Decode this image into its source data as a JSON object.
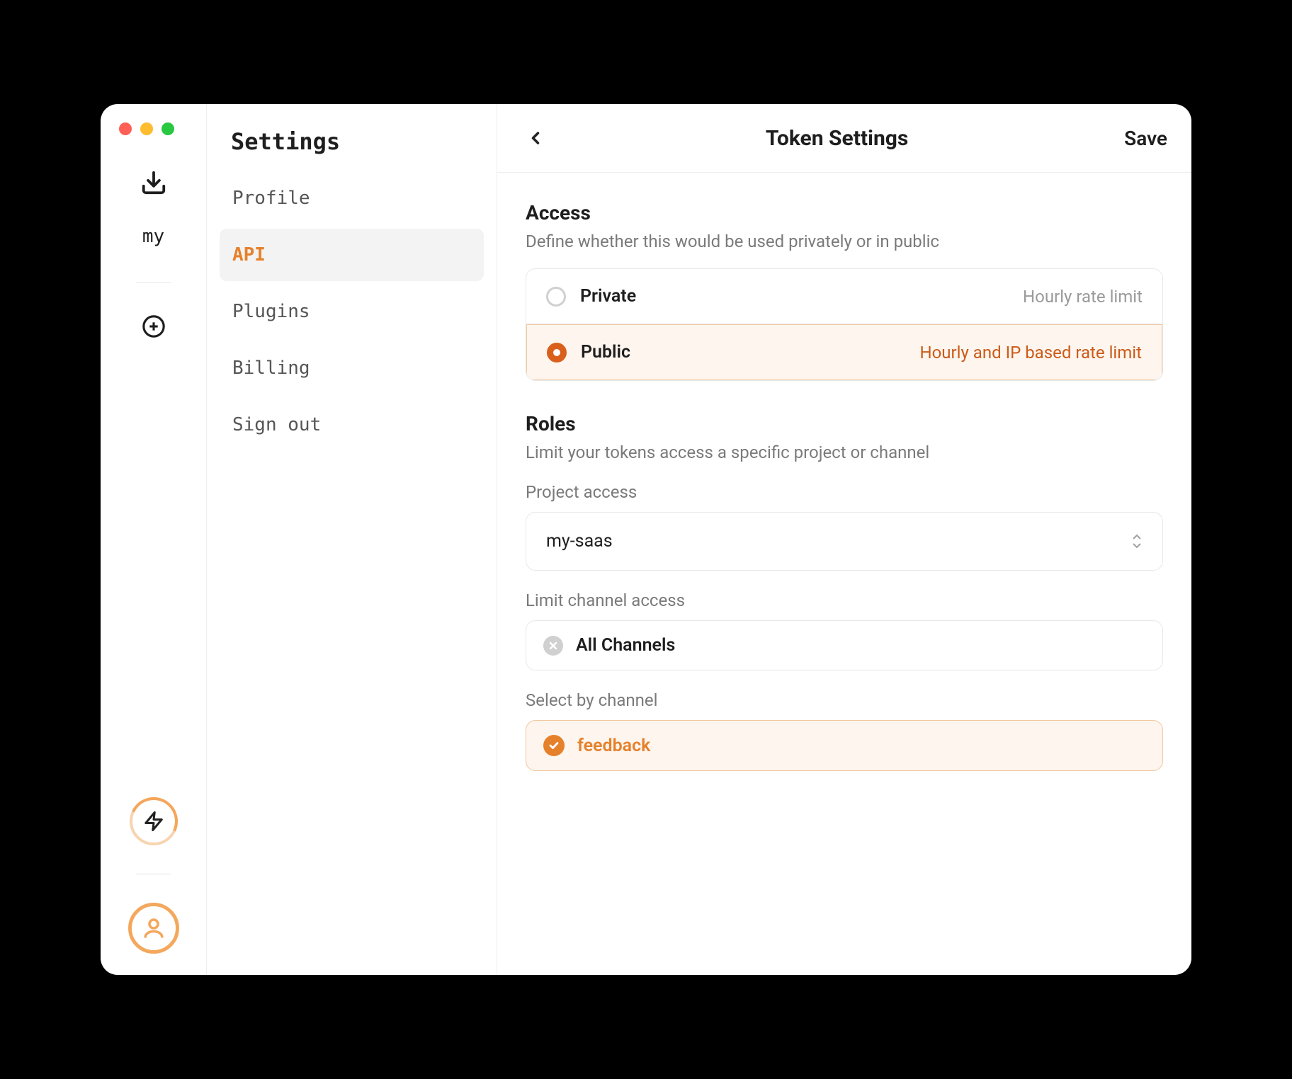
{
  "rail": {
    "project_label": "my"
  },
  "sidebar": {
    "title": "Settings",
    "items": [
      {
        "label": "Profile"
      },
      {
        "label": "API"
      },
      {
        "label": "Plugins"
      },
      {
        "label": "Billing"
      },
      {
        "label": "Sign out"
      }
    ]
  },
  "header": {
    "title": "Token Settings",
    "save_label": "Save"
  },
  "access": {
    "title": "Access",
    "description": "Define whether this would be used privately or in public",
    "options": [
      {
        "label": "Private",
        "note": "Hourly rate limit"
      },
      {
        "label": "Public",
        "note": "Hourly and IP based rate limit"
      }
    ],
    "selected": 1
  },
  "roles": {
    "title": "Roles",
    "description": "Limit your tokens access a specific project or channel",
    "project_label": "Project access",
    "project_value": "my-saas",
    "limit_channel_label": "Limit channel access",
    "limit_channel_value": "All Channels",
    "select_by_label": "Select by channel",
    "selected_channel": "feedback"
  },
  "colors": {
    "accent": "#e5812b",
    "accent_dark": "#d9601c",
    "accent_bg": "#fdf5ee"
  }
}
